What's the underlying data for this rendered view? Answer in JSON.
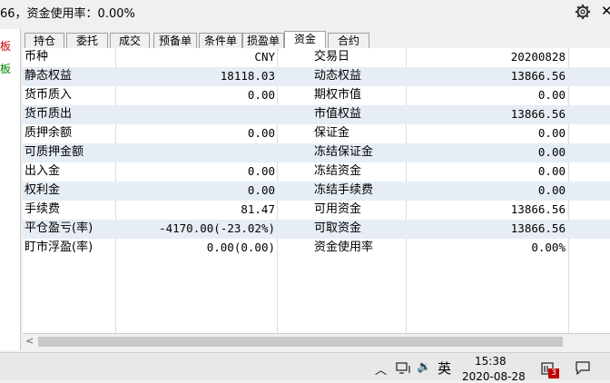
{
  "header": {
    "status_text": "66，资金使用率：0.00%"
  },
  "left_strip": {
    "label_top": "板",
    "label_bottom": "板"
  },
  "tabs": [
    "持仓",
    "委托",
    "成交",
    "预备单",
    "条件单",
    "损盈单",
    "资金",
    "合约"
  ],
  "active_tab": "资金",
  "rows": [
    [
      "币种",
      "CNY",
      "交易日",
      "20200828"
    ],
    [
      "静态权益",
      "18118.03",
      "动态权益",
      "13866.56"
    ],
    [
      "货币质入",
      "0.00",
      "期权市值",
      "0.00"
    ],
    [
      "货币质出",
      "",
      "市值权益",
      "13866.56"
    ],
    [
      "质押余额",
      "0.00",
      "保证金",
      "0.00"
    ],
    [
      "可质押金额",
      "",
      "冻结保证金",
      "0.00"
    ],
    [
      "出入金",
      "0.00",
      "冻结资金",
      "0.00"
    ],
    [
      "权利金",
      "0.00",
      "冻结手续费",
      "0.00"
    ],
    [
      "手续费",
      "81.47",
      "可用资金",
      "13866.56"
    ],
    [
      "平仓盈亏(率)",
      "-4170.00(-23.02%)",
      "可取资金",
      "13866.56"
    ],
    [
      "盯市浮盈(率)",
      "0.00(0.00)",
      "资金使用率",
      "0.00%"
    ]
  ],
  "taskbar": {
    "ime": "英",
    "time": "15:38",
    "date": "2020-08-28",
    "notification_count": "3"
  }
}
